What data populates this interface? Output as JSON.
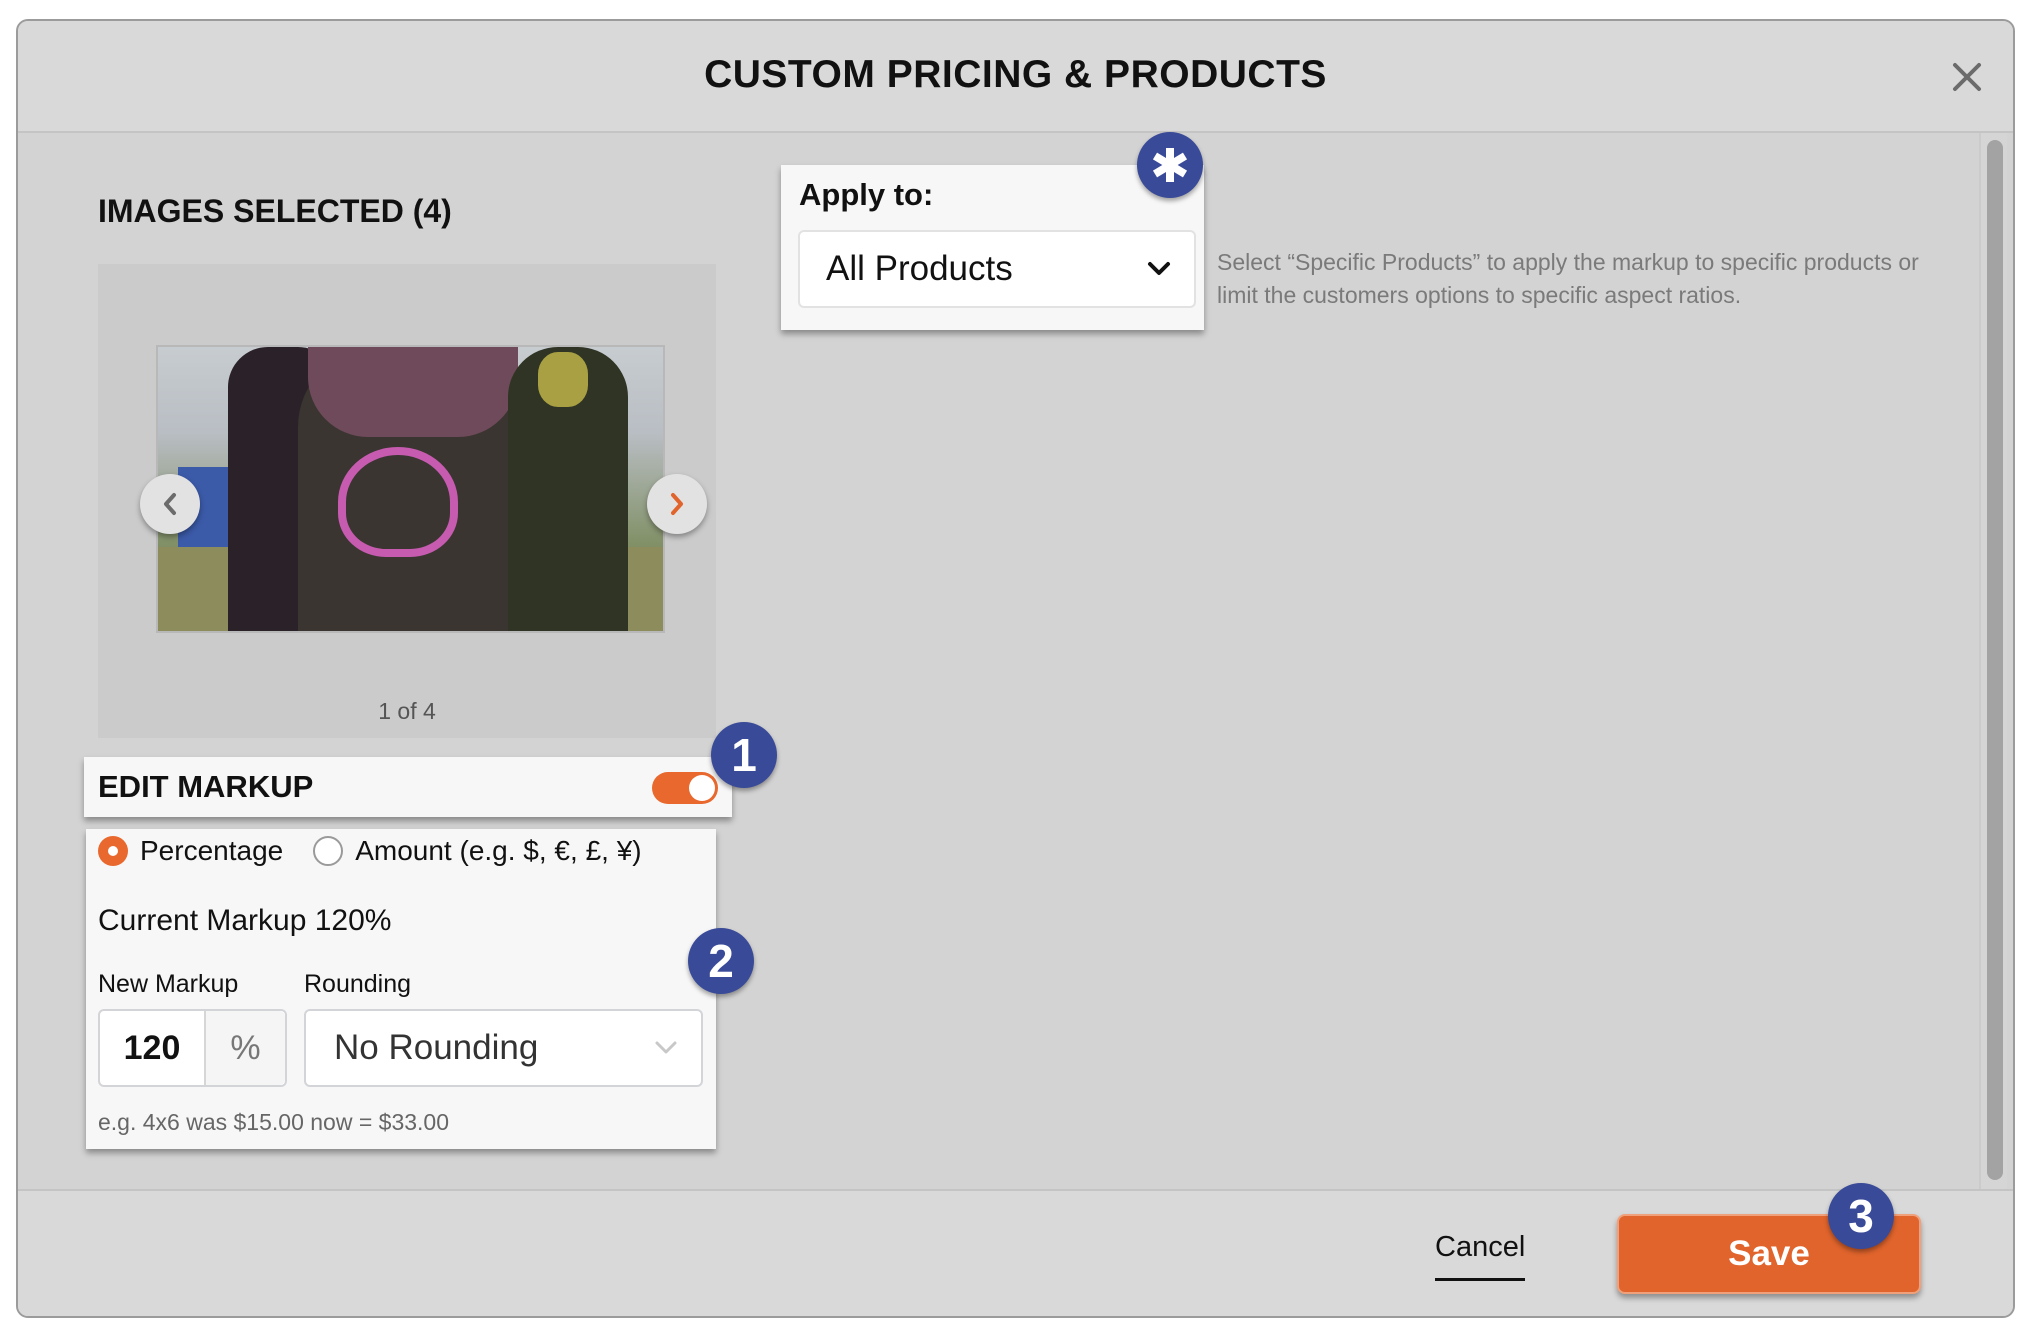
{
  "modal": {
    "title": "CUSTOM PRICING & PRODUCTS",
    "close_icon": "close-icon"
  },
  "images": {
    "heading": "IMAGES SELECTED (4)",
    "photo_alt": "Festival photo: people with colorful powder, heart painted on jacket",
    "prev_icon": "chevron-left-icon",
    "next_icon": "chevron-right-icon",
    "current_index": 1,
    "total": 4,
    "pager_text": "1 of 4"
  },
  "edit_markup": {
    "title": "EDIT MARKUP",
    "enabled": true,
    "options": [
      {
        "label": "Percentage",
        "selected": true
      },
      {
        "label": "Amount (e.g. $, €, £, ¥)",
        "selected": false
      }
    ],
    "current_markup": "Current Markup 120%",
    "new_markup_label": "New Markup",
    "new_markup_value": "120",
    "new_markup_unit": "%",
    "rounding_label": "Rounding",
    "rounding_value": "No Rounding",
    "example": "e.g. 4x6 was $15.00 now = $33.00"
  },
  "apply_to": {
    "label": "Apply to:",
    "value": "All Products",
    "help": "Select “Specific Products” to apply the markup to specific products or limit the customers options to specific aspect ratios."
  },
  "badges": {
    "asterisk": "*",
    "step1": "1",
    "step2": "2",
    "step3": "3"
  },
  "footer": {
    "cancel_label": "Cancel",
    "save_label": "Save"
  },
  "colors": {
    "accent_orange": "#e0642c",
    "badge_blue": "#394a98",
    "modal_bg": "#d6d6d6"
  }
}
